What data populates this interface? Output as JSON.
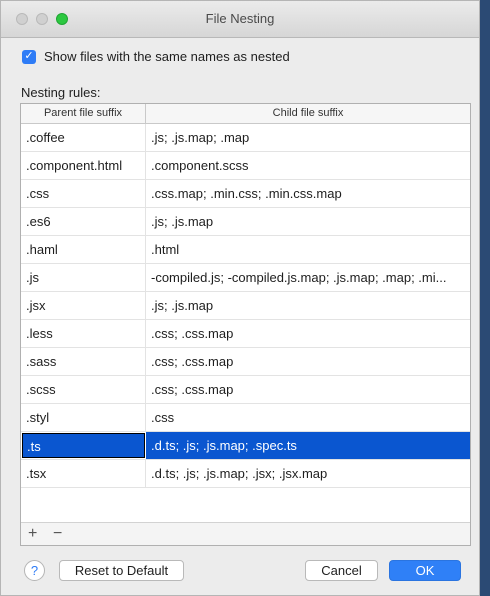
{
  "window": {
    "title": "File Nesting"
  },
  "option": {
    "label": "Show files with the same names as nested",
    "checked": true
  },
  "rules": {
    "label": "Nesting rules:",
    "columns": {
      "parent": "Parent file suffix",
      "child": "Child file suffix"
    },
    "rows": [
      {
        "parent": ".coffee",
        "child": ".js; .js.map; .map"
      },
      {
        "parent": ".component.html",
        "child": ".component.scss"
      },
      {
        "parent": ".css",
        "child": ".css.map; .min.css; .min.css.map"
      },
      {
        "parent": ".es6",
        "child": ".js; .js.map"
      },
      {
        "parent": ".haml",
        "child": ".html"
      },
      {
        "parent": ".js",
        "child": "-compiled.js; -compiled.js.map; .js.map; .map; .mi..."
      },
      {
        "parent": ".jsx",
        "child": ".js; .js.map"
      },
      {
        "parent": ".less",
        "child": ".css; .css.map"
      },
      {
        "parent": ".sass",
        "child": ".css; .css.map"
      },
      {
        "parent": ".scss",
        "child": ".css; .css.map"
      },
      {
        "parent": ".styl",
        "child": ".css"
      },
      {
        "parent": ".ts",
        "child": ".d.ts; .js; .js.map; .spec.ts",
        "selected": true
      },
      {
        "parent": ".tsx",
        "child": ".d.ts; .js; .js.map; .jsx; .jsx.map"
      }
    ]
  },
  "toolbar": {
    "add_glyph": "+",
    "remove_glyph": "−"
  },
  "buttons": {
    "help": "?",
    "reset": "Reset to Default",
    "cancel": "Cancel",
    "ok": "OK"
  }
}
